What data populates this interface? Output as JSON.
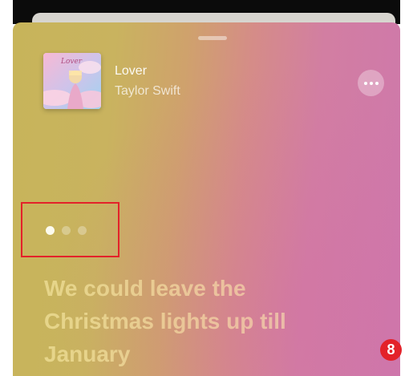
{
  "now_playing": {
    "title": "Lover",
    "artist": "Taylor Swift",
    "more_icon": "ellipsis-icon",
    "artwork_text": "Lover"
  },
  "pager": {
    "page_count": 3,
    "active_index": 0
  },
  "lyrics": {
    "lines": [
      "We could leave the",
      "Christmas lights up till",
      "January"
    ]
  },
  "annotation": {
    "step_number": "8",
    "highlight_color": "#e3222a"
  }
}
